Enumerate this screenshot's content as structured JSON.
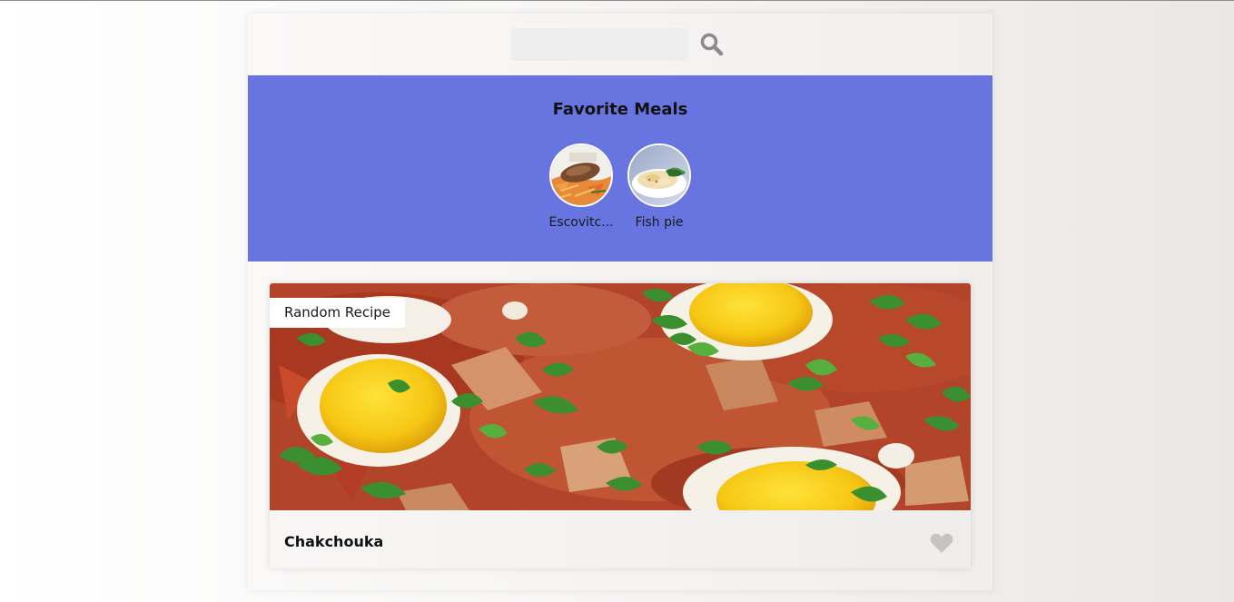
{
  "search": {
    "placeholder": "",
    "value": "",
    "icon": "search-icon"
  },
  "favorites": {
    "title": "Favorite Meals",
    "items": [
      {
        "name": "Escovitch Fish",
        "display_name": "Escovitc..."
      },
      {
        "name": "Fish pie",
        "display_name": "Fish pie"
      }
    ]
  },
  "meal": {
    "tag": "Random Recipe",
    "title": "Chakchouka",
    "favorite_icon": "heart-icon",
    "favorited": false
  },
  "colors": {
    "favorites_bg": "#6875e0",
    "search_icon": "#8c8990",
    "heart_icon": "#c8c3c3"
  }
}
